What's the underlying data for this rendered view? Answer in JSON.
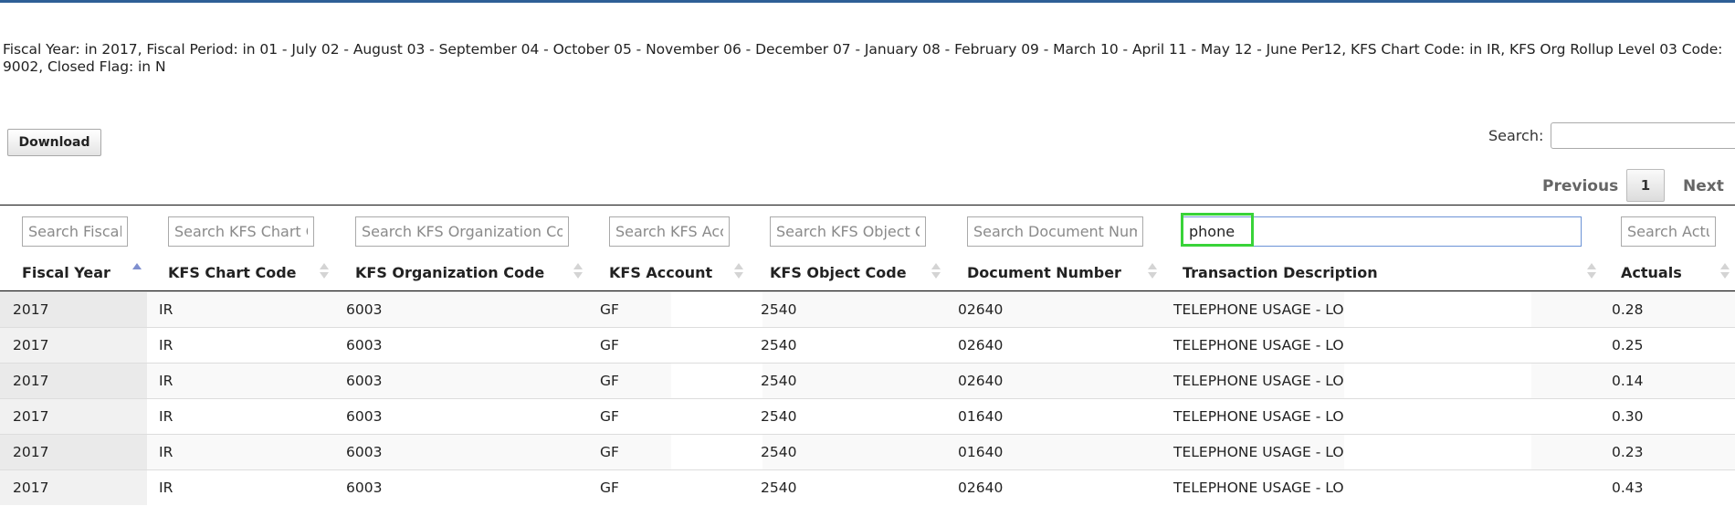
{
  "filters_text": "Fiscal Year: in 2017, Fiscal Period: in 01 - July 02 - August 03 - September 04 - October 05 - November 06 - December 07 - January 08 - February 09 - March 10 - April 11 - May 12 - June Per12, KFS Chart Code: in IR, KFS Org Rollup Level 03 Code:",
  "filters_text_2": "9002, Closed Flag: in N",
  "toolbar": {
    "download_label": "Download"
  },
  "search": {
    "label": "Search:",
    "value": ""
  },
  "pager": {
    "previous_label": "Previous",
    "page": "1",
    "next_label": "Next"
  },
  "column_filters": {
    "fiscal_year": {
      "placeholder": "Search Fiscal Year",
      "value": ""
    },
    "chart_code": {
      "placeholder": "Search KFS Chart Code",
      "value": ""
    },
    "org_code": {
      "placeholder": "Search KFS Organization Code",
      "value": ""
    },
    "account": {
      "placeholder": "Search KFS Account",
      "value": ""
    },
    "object_code": {
      "placeholder": "Search KFS Object Code",
      "value": ""
    },
    "document_number": {
      "placeholder": "Search Document Number",
      "value": ""
    },
    "transaction_description": {
      "placeholder": "",
      "value": "phone"
    },
    "actuals": {
      "placeholder": "Search Actuals",
      "value": ""
    }
  },
  "columns": [
    "Fiscal Year",
    "KFS Chart Code",
    "KFS Organization Code",
    "KFS Account",
    "KFS Object Code",
    "Document Number",
    "Transaction Description",
    "Actuals"
  ],
  "sort": {
    "column": "Fiscal Year",
    "direction": "ascending"
  },
  "rows": [
    [
      "2017",
      "IR",
      "6003",
      "GF",
      "2540",
      "02640",
      "TELEPHONE USAGE - LO",
      "0.28"
    ],
    [
      "2017",
      "IR",
      "6003",
      "GF",
      "2540",
      "02640",
      "TELEPHONE USAGE - LO",
      "0.25"
    ],
    [
      "2017",
      "IR",
      "6003",
      "GF",
      "2540",
      "02640",
      "TELEPHONE USAGE - LO",
      "0.14"
    ],
    [
      "2017",
      "IR",
      "6003",
      "GF",
      "2540",
      "01640",
      "TELEPHONE USAGE - LO",
      "0.30"
    ],
    [
      "2017",
      "IR",
      "6003",
      "GF",
      "2540",
      "01640",
      "TELEPHONE USAGE - LO",
      "0.23"
    ],
    [
      "2017",
      "IR",
      "6003",
      "GF",
      "2540",
      "02640",
      "TELEPHONE USAGE - LO",
      "0.43"
    ]
  ],
  "colors": {
    "accent_bar": "#2e5f96",
    "focus_ring": "#39d339",
    "sort_active": "#7f8fcf"
  }
}
